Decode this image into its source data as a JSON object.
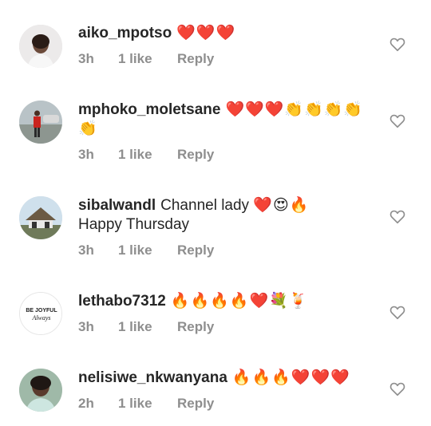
{
  "comments": [
    {
      "username": "aiko_mpotso",
      "text": "",
      "emojis": "❤️❤️❤️",
      "time": "3h",
      "likes": "1 like",
      "reply": "Reply"
    },
    {
      "username": "mphoko_moletsane",
      "text": "",
      "emojis": "❤️❤️❤️👏👏👏👏👏",
      "time": "3h",
      "likes": "1 like",
      "reply": "Reply"
    },
    {
      "username": "sibalwandl",
      "text": "Channel lady",
      "emojis": "❤️😍🔥",
      "text2": "Happy Thursday",
      "time": "3h",
      "likes": "1 like",
      "reply": "Reply"
    },
    {
      "username": "lethabo7312",
      "text": "",
      "emojis": "🔥🔥🔥🔥❤️💐🍹",
      "time": "3h",
      "likes": "1 like",
      "reply": "Reply"
    },
    {
      "username": "nelisiwe_nkwanyana",
      "text": "",
      "emojis": "🔥🔥🔥❤️❤️❤️",
      "time": "2h",
      "likes": "1 like",
      "reply": "Reply"
    }
  ],
  "avatars": {
    "lethabo_logo_text": "BE JOYFUL\nAlways"
  }
}
